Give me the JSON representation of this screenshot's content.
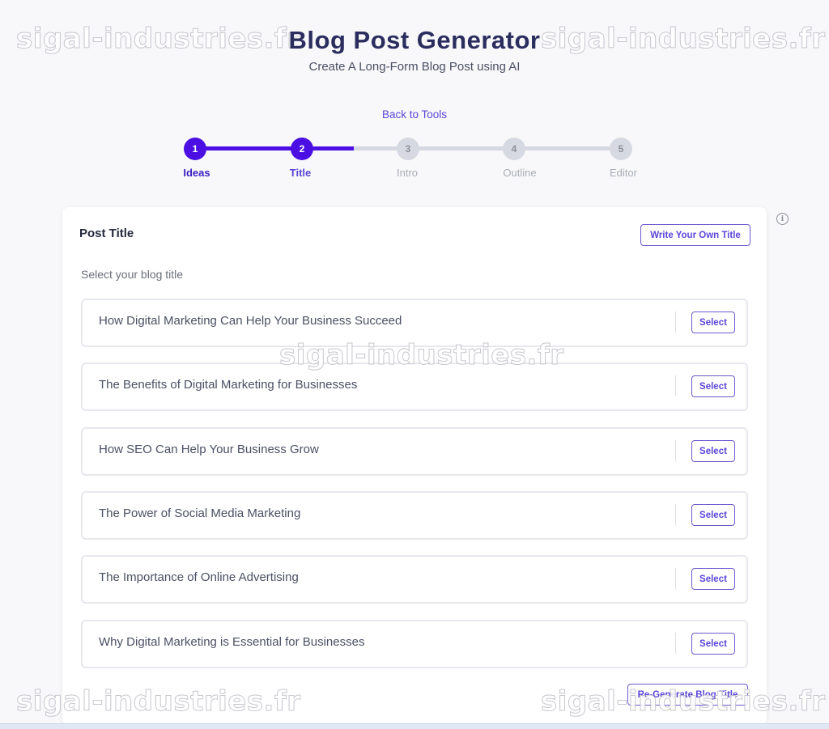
{
  "header": {
    "title": "Blog Post Generator",
    "subtitle": "Create A Long-Form Blog Post using AI",
    "back_link": "Back to Tools"
  },
  "stepper": {
    "steps": [
      {
        "number": "1",
        "label": "Ideas",
        "state": "done"
      },
      {
        "number": "2",
        "label": "Title",
        "state": "current"
      },
      {
        "number": "3",
        "label": "Intro",
        "state": "pending"
      },
      {
        "number": "4",
        "label": "Outline",
        "state": "pending"
      },
      {
        "number": "5",
        "label": "Editor",
        "state": "pending"
      }
    ]
  },
  "card": {
    "title": "Post Title",
    "write_own_label": "Write Your Own Title",
    "hint": "Select your blog title",
    "options": [
      {
        "text": "How Digital Marketing Can Help Your Business Succeed",
        "button": "Select"
      },
      {
        "text": "The Benefits of Digital Marketing for Businesses",
        "button": "Select"
      },
      {
        "text": "How SEO Can Help Your Business Grow",
        "button": "Select"
      },
      {
        "text": "The Power of Social Media Marketing",
        "button": "Select"
      },
      {
        "text": "The Importance of Online Advertising",
        "button": "Select"
      },
      {
        "text": "Why Digital Marketing is Essential for Businesses",
        "button": "Select"
      }
    ],
    "regenerate_label": "Re-Generate Blog Title"
  },
  "watermark": {
    "text": "sigal-industries.fr"
  },
  "icons": {
    "info": "info-icon",
    "info_glyph": "i"
  },
  "colors": {
    "accent": "#4c0fe3",
    "link": "#5b46d8",
    "title": "#2b2d5e",
    "inactive_step": "#d6d9e1"
  }
}
